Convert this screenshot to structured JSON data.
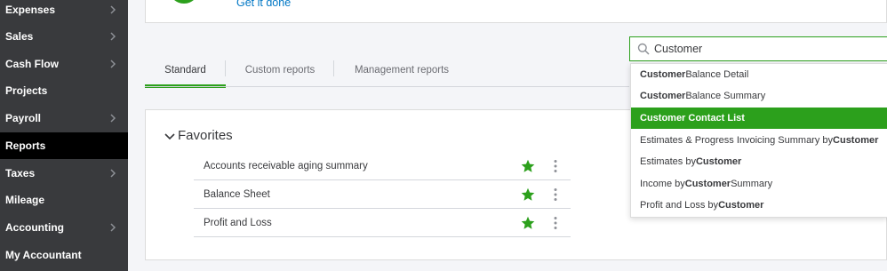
{
  "sidebar": {
    "items": [
      {
        "label": "Expenses",
        "chevron": true
      },
      {
        "label": "Sales",
        "chevron": true
      },
      {
        "label": "Cash Flow",
        "chevron": true
      },
      {
        "label": "Projects",
        "chevron": false
      },
      {
        "label": "Payroll",
        "chevron": true
      },
      {
        "label": "Reports",
        "chevron": false,
        "active": true
      },
      {
        "label": "Taxes",
        "chevron": true
      },
      {
        "label": "Mileage",
        "chevron": false
      },
      {
        "label": "Accounting",
        "chevron": true
      },
      {
        "label": "My Accountant",
        "chevron": false
      }
    ]
  },
  "banner": {
    "link": "Get it done"
  },
  "tabs": [
    {
      "label": "Standard",
      "active": true
    },
    {
      "label": "Custom reports",
      "active": false
    },
    {
      "label": "Management reports",
      "active": false
    }
  ],
  "favorites": {
    "title": "Favorites",
    "rows": [
      {
        "label": "Accounts receivable aging summary"
      },
      {
        "label": "Balance Sheet"
      },
      {
        "label": "Profit and Loss"
      }
    ]
  },
  "search": {
    "value": "Customer",
    "icon": "search-icon"
  },
  "dropdown": {
    "items": [
      {
        "before": "",
        "bold": "Customer",
        "after": " Balance Detail"
      },
      {
        "before": "",
        "bold": "Customer",
        "after": " Balance Summary"
      },
      {
        "before": "",
        "bold": "Customer Contact List",
        "after": "",
        "active": true
      },
      {
        "before": "Estimates & Progress Invoicing Summary by ",
        "bold": "Customer",
        "after": ""
      },
      {
        "before": "Estimates by ",
        "bold": "Customer",
        "after": ""
      },
      {
        "before": "Income by ",
        "bold": "Customer",
        "after": " Summary"
      },
      {
        "before": "Profit and Loss by ",
        "bold": "Customer",
        "after": ""
      }
    ]
  },
  "colors": {
    "accent": "#2ca01c",
    "sidebar_bg": "#393a3d",
    "sidebar_active": "#000000",
    "link": "#0077c5"
  }
}
